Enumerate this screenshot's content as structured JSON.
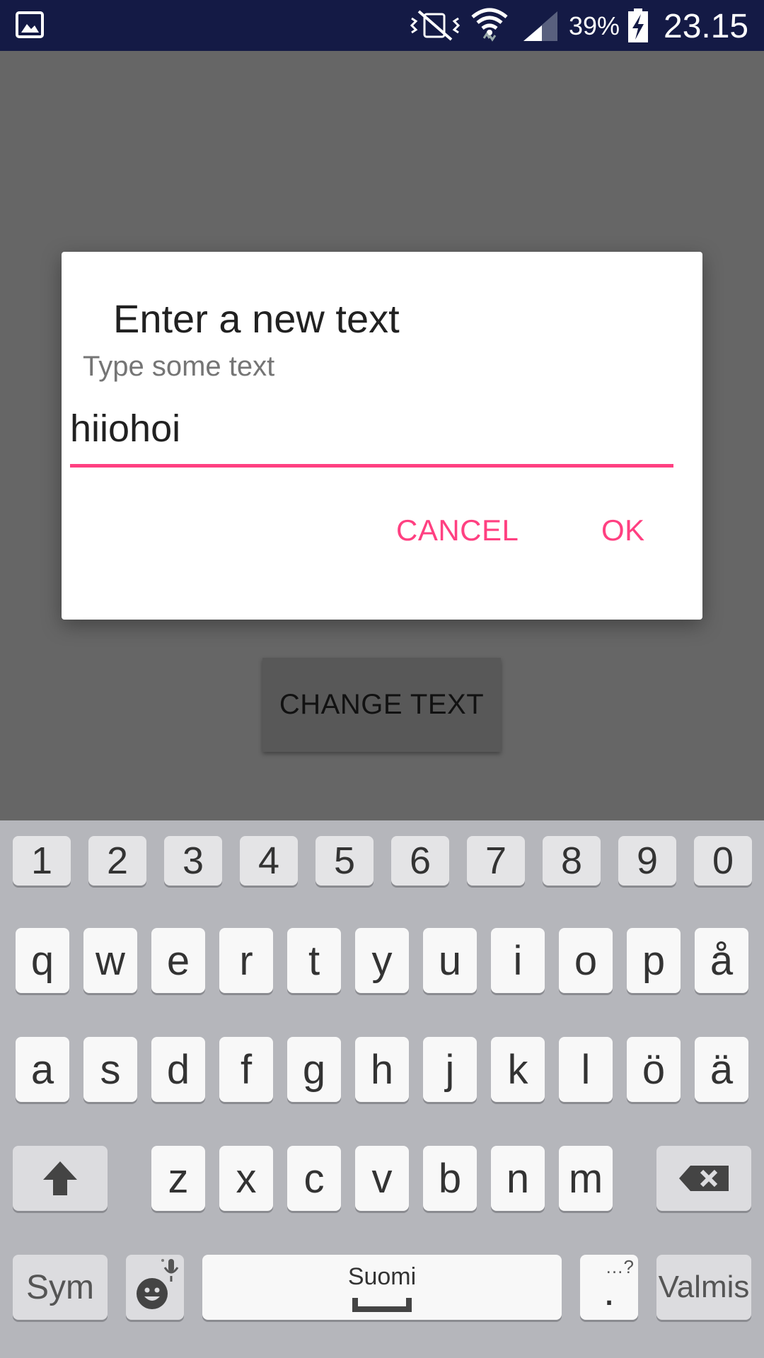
{
  "status_bar": {
    "battery_percent": "39%",
    "clock": "23.15",
    "icons": [
      "gallery-icon",
      "vibrate-mute-icon",
      "wifi-icon",
      "signal-icon",
      "battery-charging-icon"
    ]
  },
  "app": {
    "button_label": "CHANGE TEXT"
  },
  "dialog": {
    "title": "Enter a new text",
    "message": "Type some text",
    "input_value": "hiiohoi",
    "cancel_label": "CANCEL",
    "ok_label": "OK",
    "accent_color": "#ff4081"
  },
  "keyboard": {
    "number_row": [
      "1",
      "2",
      "3",
      "4",
      "5",
      "6",
      "7",
      "8",
      "9",
      "0"
    ],
    "row1": [
      "q",
      "w",
      "e",
      "r",
      "t",
      "y",
      "u",
      "i",
      "o",
      "p",
      "å"
    ],
    "row2": [
      "a",
      "s",
      "d",
      "f",
      "g",
      "h",
      "j",
      "k",
      "l",
      "ö",
      "ä"
    ],
    "row3": [
      "z",
      "x",
      "c",
      "v",
      "b",
      "n",
      "m"
    ],
    "sym_label": "Sym",
    "space_label": "Suomi",
    "dot_label": ".",
    "dot_hint": "…?",
    "done_label": "Valmis",
    "icons": [
      "shift-icon",
      "backspace-icon",
      "emoji-icon",
      "microphone-icon"
    ]
  }
}
